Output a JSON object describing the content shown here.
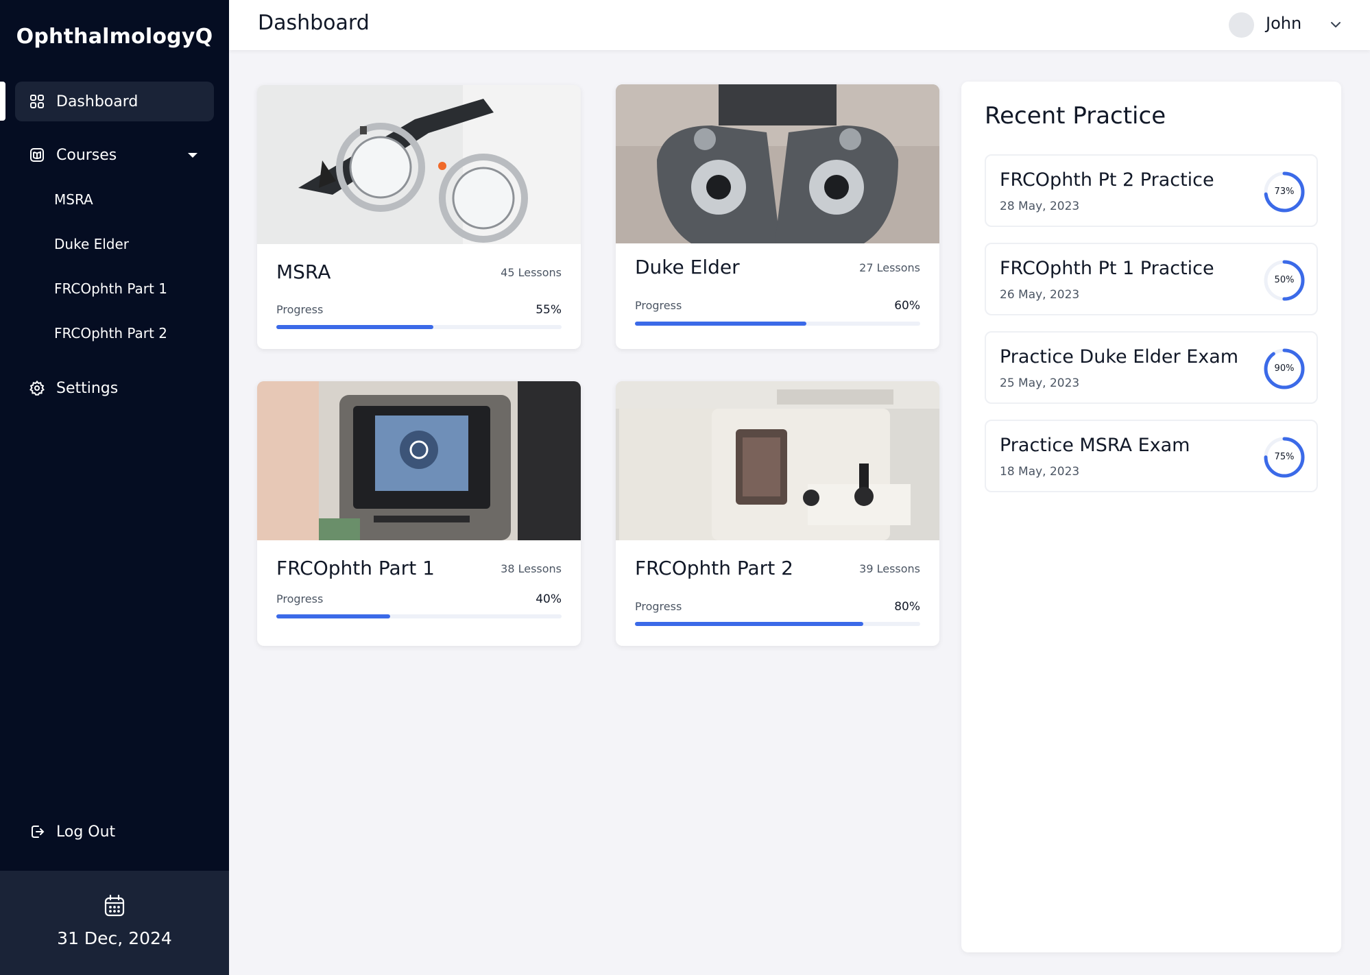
{
  "app": {
    "brand": "OphthalmologyQ"
  },
  "sidebar": {
    "dashboard": "Dashboard",
    "courses": "Courses",
    "course_items": [
      "MSRA",
      "Duke Elder",
      "FRCOphth Part 1",
      "FRCOphth Part 2"
    ],
    "settings": "Settings",
    "logout": "Log Out",
    "date": "31 Dec, 2024"
  },
  "header": {
    "title": "Dashboard",
    "user": "John"
  },
  "courses": [
    {
      "title": "MSRA",
      "lessons": "45 Lessons",
      "progress_label": "Progress",
      "progress_text": "55%",
      "progress": 55
    },
    {
      "title": "Duke Elder",
      "lessons": "27 Lessons",
      "progress_label": "Progress",
      "progress_text": "60%",
      "progress": 60
    },
    {
      "title": "FRCOphth Part 1",
      "lessons": "38 Lessons",
      "progress_label": "Progress",
      "progress_text": "40%",
      "progress": 40
    },
    {
      "title": "FRCOphth Part 2",
      "lessons": "39 Lessons",
      "progress_label": "Progress",
      "progress_text": "80%",
      "progress": 80
    }
  ],
  "recent": {
    "title": "Recent Practice",
    "items": [
      {
        "title": "FRCOphth Pt 2 Practice",
        "date": "28 May, 2023",
        "score_text": "73%",
        "score": 73
      },
      {
        "title": "FRCOphth Pt 1 Practice",
        "date": "26 May, 2023",
        "score_text": "50%",
        "score": 50
      },
      {
        "title": "Practice Duke Elder Exam",
        "date": "25 May, 2023",
        "score_text": "90%",
        "score": 90
      },
      {
        "title": "Practice MSRA Exam",
        "date": "18 May, 2023",
        "score_text": "75%",
        "score": 75
      }
    ]
  },
  "colors": {
    "sidebar_bg": "#050d22",
    "sidebar_active": "#1a2337",
    "accent": "#3b6ae8",
    "page_bg": "#f4f4f8"
  },
  "icons": {
    "dashboard": "grid-icon",
    "courses": "book-icon",
    "settings": "gear-icon",
    "logout": "logout-icon",
    "calendar": "calendar-icon",
    "user_menu": "chevron-down-icon"
  }
}
